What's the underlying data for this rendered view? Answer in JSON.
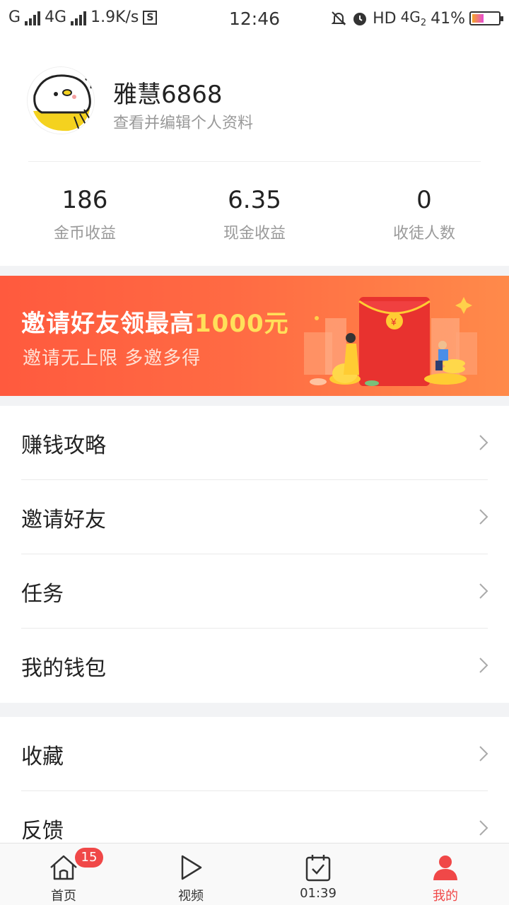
{
  "status_bar": {
    "carrier1": "G",
    "carrier2": "4G",
    "speed": "1.9K/s",
    "s_icon": "S",
    "time": "12:46",
    "hd": "HD",
    "network": "4G",
    "network_sub": "2",
    "battery": "41%"
  },
  "profile": {
    "username": "雅慧6868",
    "subtitle": "查看并编辑个人资料"
  },
  "stats": [
    {
      "value": "186",
      "label": "金币收益"
    },
    {
      "value": "6.35",
      "label": "现金收益"
    },
    {
      "value": "0",
      "label": "收徒人数"
    }
  ],
  "banner": {
    "title_prefix": "邀请好友领最高",
    "title_highlight": "1000元",
    "subtitle": "邀请无上限 多邀多得"
  },
  "menu_group1": [
    "赚钱攻略",
    "邀请好友",
    "任务",
    "我的钱包"
  ],
  "menu_group2": [
    "收藏",
    "反馈"
  ],
  "tabbar": {
    "home": "首页",
    "home_badge": "15",
    "video": "视频",
    "timer": "01:39",
    "me": "我的"
  },
  "colors": {
    "accent": "#f04848",
    "banner_start": "#ff5a3e",
    "banner_end": "#ff8a4a",
    "highlight": "#ffe05a"
  }
}
